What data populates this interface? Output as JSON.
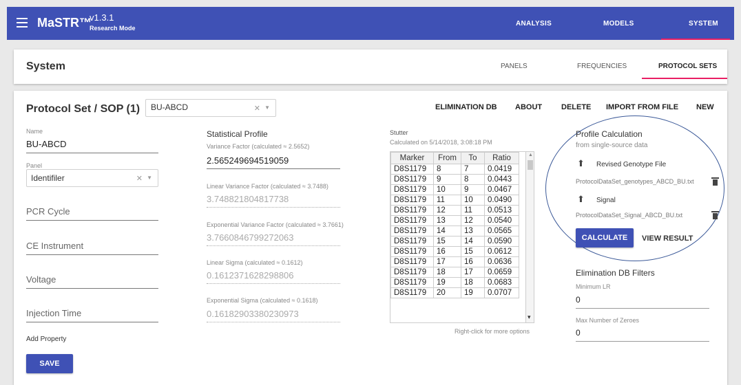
{
  "app": {
    "name": "MaSTR™",
    "version": "v1.3.1",
    "mode": "Research Mode",
    "nav": [
      "ANALYSIS",
      "MODELS",
      "SYSTEM"
    ]
  },
  "system": {
    "title": "System",
    "tabs": [
      "PANELS",
      "FREQUENCIES",
      "PROTOCOL SETS"
    ]
  },
  "protocol": {
    "title": "Protocol Set / SOP (1)",
    "selected": "BU-ABCD",
    "actions": [
      "ELIMINATION DB",
      "ABOUT",
      "DELETE",
      "IMPORT FROM FILE",
      "NEW"
    ]
  },
  "fields": {
    "name_label": "Name",
    "name_value": "BU-ABCD",
    "panel_label": "Panel",
    "panel_value": "Identifiler",
    "pcr": "PCR Cycle",
    "ce": "CE Instrument",
    "voltage": "Voltage",
    "injection": "Injection Time",
    "add_property": "Add Property",
    "save": "SAVE"
  },
  "stats": {
    "title": "Statistical Profile",
    "items": [
      {
        "label": "Variance Factor (calculated ≈ 2.5652)",
        "value": "2.565249694519059"
      },
      {
        "label": "Linear Variance Factor (calculated ≈ 3.7488)",
        "value": "3.748821804817738"
      },
      {
        "label": "Exponential Variance Factor (calculated ≈ 3.7661)",
        "value": "3.7660846799272063"
      },
      {
        "label": "Linear Sigma (calculated ≈ 0.1612)",
        "value": "0.1612371628298806"
      },
      {
        "label": "Exponential Sigma (calculated ≈ 0.1618)",
        "value": "0.16182903380230973"
      }
    ]
  },
  "stutter": {
    "title": "Stutter",
    "calculated": "Calculated on 5/14/2018, 3:08:18 PM",
    "columns": [
      "Marker",
      "From",
      "To",
      "Ratio"
    ],
    "rows": [
      [
        "D8S1179",
        "8",
        "7",
        "0.0419"
      ],
      [
        "D8S1179",
        "9",
        "8",
        "0.0443"
      ],
      [
        "D8S1179",
        "10",
        "9",
        "0.0467"
      ],
      [
        "D8S1179",
        "11",
        "10",
        "0.0490"
      ],
      [
        "D8S1179",
        "12",
        "11",
        "0.0513"
      ],
      [
        "D8S1179",
        "13",
        "12",
        "0.0540"
      ],
      [
        "D8S1179",
        "14",
        "13",
        "0.0565"
      ],
      [
        "D8S1179",
        "15",
        "14",
        "0.0590"
      ],
      [
        "D8S1179",
        "16",
        "15",
        "0.0612"
      ],
      [
        "D8S1179",
        "17",
        "16",
        "0.0636"
      ],
      [
        "D8S1179",
        "18",
        "17",
        "0.0659"
      ],
      [
        "D8S1179",
        "19",
        "18",
        "0.0683"
      ],
      [
        "D8S1179",
        "20",
        "19",
        "0.0707"
      ]
    ],
    "hint": "Right-click for more options"
  },
  "profile": {
    "title": "Profile Calculation",
    "subtitle": "from single-source data",
    "genotype_label": "Revised Genotype File",
    "genotype_file": "ProtocolDataSet_genotypes_ABCD_BU.txt",
    "signal_label": "Signal",
    "signal_file": "ProtocolDataSet_Signal_ABCD_BU.txt",
    "calculate": "CALCULATE",
    "view_result": "VIEW RESULT"
  },
  "elim": {
    "title": "Elimination DB Filters",
    "min_lr_label": "Minimum LR",
    "min_lr_value": "0",
    "max_zero_label": "Max Number of Zeroes",
    "max_zero_value": "0"
  },
  "colors": {
    "primary": "#3f51b5",
    "accent": "#e91e63"
  }
}
